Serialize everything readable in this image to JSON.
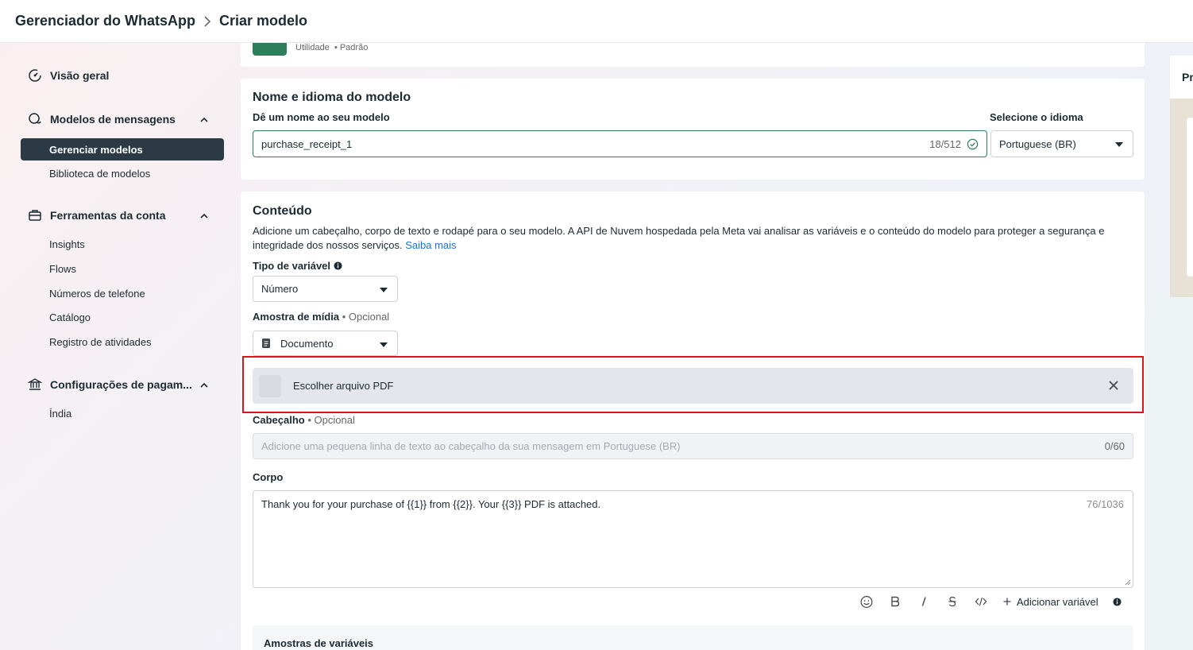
{
  "header": {
    "app_title": "Gerenciador do WhatsApp",
    "page_title": "Criar modelo"
  },
  "sidebar": {
    "overview": "Visão geral",
    "message_templates": {
      "label": "Modelos de mensagens",
      "items": [
        "Gerenciar modelos",
        "Biblioteca de modelos"
      ]
    },
    "account_tools": {
      "label": "Ferramentas da conta",
      "items": [
        "Insights",
        "Flows",
        "Números de telefone",
        "Catálogo",
        "Registro de atividades"
      ]
    },
    "payment_settings": {
      "label": "Configurações de pagam...",
      "items": [
        "Índia"
      ]
    }
  },
  "category": {
    "type": "Utilidade",
    "subtype": "• Padrão"
  },
  "name_section": {
    "title": "Nome e idioma do modelo",
    "name_label": "Dê um nome ao seu modelo",
    "name_value": "purchase_receipt_1",
    "name_counter": "18/512",
    "language_label": "Selecione o idioma",
    "language_value": "Portuguese (BR)"
  },
  "content_section": {
    "title": "Conteúdo",
    "description": "Adicione um cabeçalho, corpo de texto e rodapé para o seu modelo. A API de Nuvem hospedada pela Meta vai analisar as variáveis e o conteúdo do modelo para proteger a segurança e integridade dos nossos serviços.",
    "learn_more": "Saiba mais",
    "variable_type_label": "Tipo de variável",
    "variable_type_value": "Número",
    "media_sample_label": "Amostra de mídia",
    "optional": "• Opcional",
    "media_sample_value": "Documento",
    "choose_file": "Escolher arquivo PDF",
    "header_label": "Cabeçalho",
    "header_placeholder": "Adicione uma pequena linha de texto ao cabeçalho da sua mensagem em Portuguese (BR)",
    "header_counter": "0/60",
    "body_label": "Corpo",
    "body_value": "Thank you for your purchase of {{1}} from {{2}}. Your {{3}} PDF is attached.",
    "body_counter": "76/1036",
    "add_variable": "Adicionar variável",
    "variable_samples_title": "Amostras de variáveis"
  },
  "preview": {
    "title_fragment": "Pr"
  },
  "colors": {
    "active_nav": "#2b3a45",
    "category_green": "#2e7d5b",
    "link_blue": "#1b74e4",
    "highlight_red": "#e0131a"
  }
}
